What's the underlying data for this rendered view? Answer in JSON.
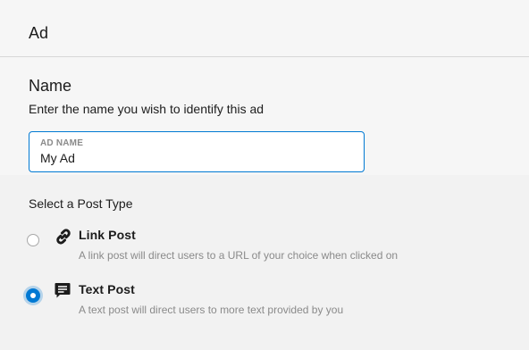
{
  "header": {
    "title": "Ad"
  },
  "name_section": {
    "title": "Name",
    "description": "Enter the name you wish to identify this ad",
    "input": {
      "label": "AD NAME",
      "value": "My Ad"
    }
  },
  "post_type_section": {
    "heading": "Select a Post Type",
    "options": [
      {
        "title": "Link Post",
        "description": "A link post will direct users to a URL of your choice when clicked on",
        "icon": "link-icon",
        "selected": false
      },
      {
        "title": "Text Post",
        "description": "A text post will direct users to more text provided by you",
        "icon": "text-post-icon",
        "selected": true
      }
    ]
  },
  "colors": {
    "accent": "#0079d3",
    "muted_text": "#8a8a8a",
    "background": "#f6f6f6"
  }
}
